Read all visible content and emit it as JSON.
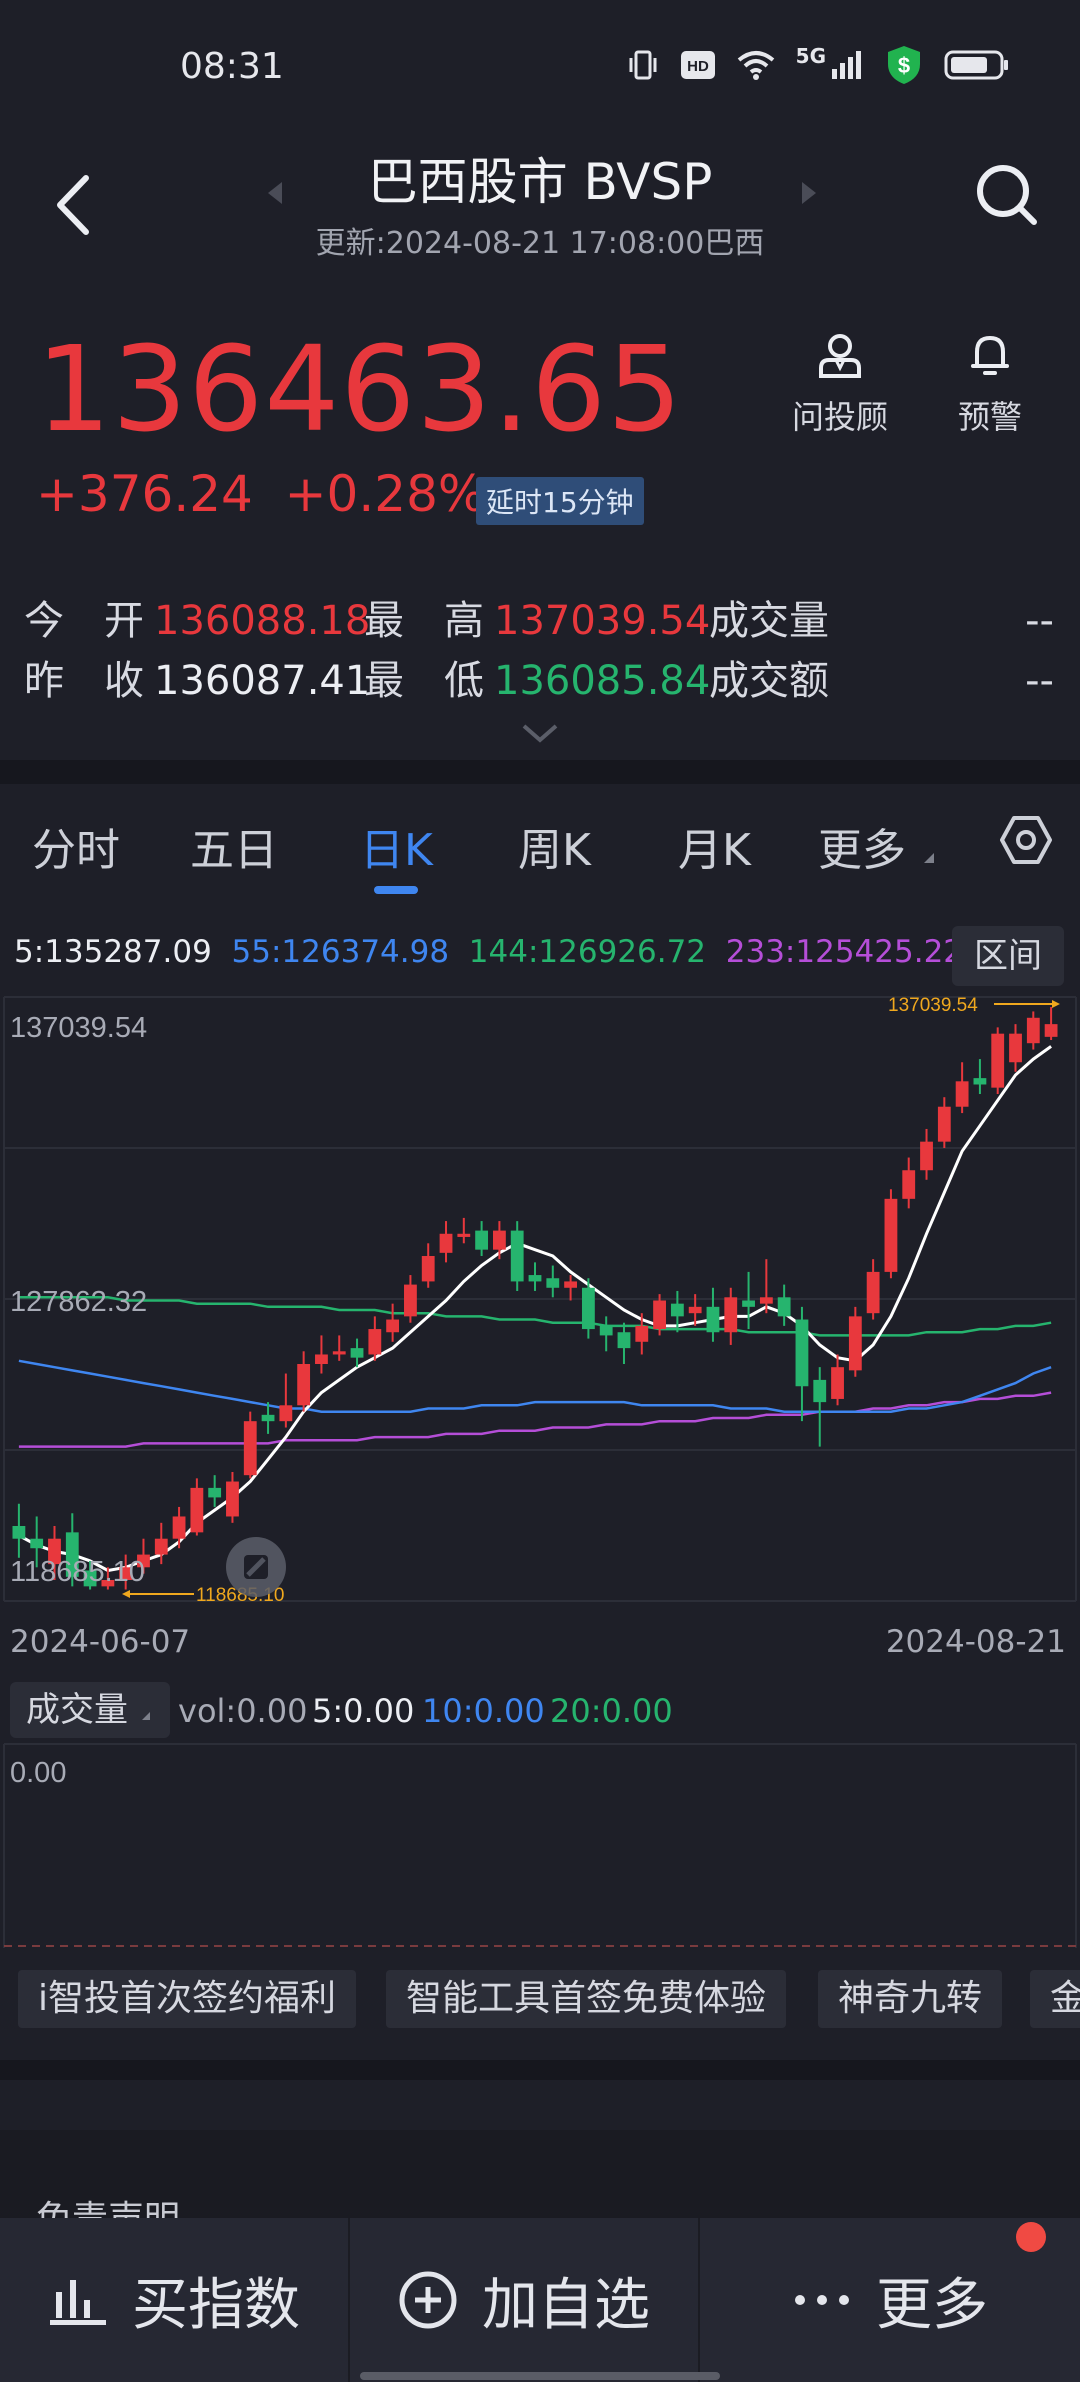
{
  "status": {
    "time": "08:31",
    "network": "5G"
  },
  "header": {
    "title": "巴西股市 BVSP",
    "update": "更新:2024-08-21 17:08:00巴西"
  },
  "quote": {
    "price": "136463.65",
    "change": "+376.24",
    "change_pct": "+0.28%",
    "delay_badge": "延时15分钟",
    "advisor_label": "问投顾",
    "alert_label": "预警",
    "stats": {
      "open_label": "今　开",
      "open": "136088.18",
      "high_label": "最　高",
      "high": "137039.54",
      "volume_label": "成交量",
      "volume": "--",
      "prev_close_label": "昨　收",
      "prev_close": "136087.41",
      "low_label": "最　低",
      "low": "136085.84",
      "amount_label": "成交额",
      "amount": "--"
    }
  },
  "tabs": [
    "分时",
    "五日",
    "日K",
    "周K",
    "月K",
    "更多"
  ],
  "active_tab": "日K",
  "ma": {
    "ma5": "5:135287.09",
    "ma55": "55:126374.98",
    "ma144": "144:126926.72",
    "ma233": "233:125425.22",
    "range_label": "区间"
  },
  "chart_data": {
    "type": "candlestick",
    "y_top_label": "137039.54",
    "y_mid_label": "127862.32",
    "y_bottom_label": "118685.10",
    "max_marker": "137039.54",
    "min_marker": "118685.10",
    "ylim": [
      118685.1,
      137039.54
    ],
    "x_start": "2024-06-07",
    "x_end": "2024-08-21",
    "candles": [
      {
        "o": 120700,
        "c": 120300,
        "h": 121400,
        "l": 119700
      },
      {
        "o": 120300,
        "c": 120000,
        "h": 121000,
        "l": 119400
      },
      {
        "o": 119500,
        "c": 120300,
        "h": 120700,
        "l": 119000
      },
      {
        "o": 120500,
        "c": 119100,
        "h": 121100,
        "l": 118800
      },
      {
        "o": 119300,
        "c": 118800,
        "h": 119600,
        "l": 118700
      },
      {
        "o": 118800,
        "c": 119000,
        "h": 119400,
        "l": 118700
      },
      {
        "o": 119000,
        "c": 119400,
        "h": 119800,
        "l": 118700
      },
      {
        "o": 119400,
        "c": 119800,
        "h": 120300,
        "l": 119200
      },
      {
        "o": 119800,
        "c": 120300,
        "h": 120800,
        "l": 119500
      },
      {
        "o": 120300,
        "c": 121000,
        "h": 121300,
        "l": 120000
      },
      {
        "o": 120500,
        "c": 121900,
        "h": 122200,
        "l": 120400
      },
      {
        "o": 121900,
        "c": 121600,
        "h": 122300,
        "l": 121300
      },
      {
        "o": 121000,
        "c": 122100,
        "h": 122400,
        "l": 120800
      },
      {
        "o": 122300,
        "c": 124000,
        "h": 124300,
        "l": 122200
      },
      {
        "o": 124200,
        "c": 124000,
        "h": 124600,
        "l": 123600
      },
      {
        "o": 124000,
        "c": 124500,
        "h": 125500,
        "l": 123800
      },
      {
        "o": 124500,
        "c": 125800,
        "h": 126200,
        "l": 124300
      },
      {
        "o": 125800,
        "c": 126100,
        "h": 126700,
        "l": 125500
      },
      {
        "o": 126100,
        "c": 126200,
        "h": 126700,
        "l": 125900
      },
      {
        "o": 126300,
        "c": 126000,
        "h": 126600,
        "l": 125700
      },
      {
        "o": 126100,
        "c": 126900,
        "h": 127300,
        "l": 125900
      },
      {
        "o": 126800,
        "c": 127200,
        "h": 127700,
        "l": 126500
      },
      {
        "o": 127300,
        "c": 128300,
        "h": 128600,
        "l": 127100
      },
      {
        "o": 128400,
        "c": 129200,
        "h": 129600,
        "l": 128200
      },
      {
        "o": 129300,
        "c": 129900,
        "h": 130300,
        "l": 129000
      },
      {
        "o": 129800,
        "c": 129900,
        "h": 130400,
        "l": 129600
      },
      {
        "o": 130000,
        "c": 129400,
        "h": 130300,
        "l": 129200
      },
      {
        "o": 129400,
        "c": 130000,
        "h": 130300,
        "l": 129100
      },
      {
        "o": 130000,
        "c": 128400,
        "h": 130300,
        "l": 128100
      },
      {
        "o": 128600,
        "c": 128400,
        "h": 129000,
        "l": 128100
      },
      {
        "o": 128500,
        "c": 128200,
        "h": 128900,
        "l": 127900
      },
      {
        "o": 128200,
        "c": 128400,
        "h": 128600,
        "l": 127800
      },
      {
        "o": 128200,
        "c": 126900,
        "h": 128500,
        "l": 126600
      },
      {
        "o": 127000,
        "c": 126700,
        "h": 127300,
        "l": 126200
      },
      {
        "o": 126800,
        "c": 126300,
        "h": 127100,
        "l": 125800
      },
      {
        "o": 126500,
        "c": 127000,
        "h": 127400,
        "l": 126100
      },
      {
        "o": 126900,
        "c": 127800,
        "h": 128000,
        "l": 126700
      },
      {
        "o": 127700,
        "c": 127300,
        "h": 128100,
        "l": 126800
      },
      {
        "o": 127400,
        "c": 127600,
        "h": 128000,
        "l": 127000
      },
      {
        "o": 127600,
        "c": 126800,
        "h": 128200,
        "l": 126500
      },
      {
        "o": 126800,
        "c": 127900,
        "h": 128200,
        "l": 126400
      },
      {
        "o": 127800,
        "c": 127600,
        "h": 128700,
        "l": 126900
      },
      {
        "o": 127700,
        "c": 127900,
        "h": 129100,
        "l": 127400
      },
      {
        "o": 127900,
        "c": 127300,
        "h": 128300,
        "l": 127000
      },
      {
        "o": 127200,
        "c": 125100,
        "h": 127600,
        "l": 124000
      },
      {
        "o": 125300,
        "c": 124600,
        "h": 125700,
        "l": 123200
      },
      {
        "o": 124700,
        "c": 125700,
        "h": 126100,
        "l": 124500
      },
      {
        "o": 125600,
        "c": 127300,
        "h": 127600,
        "l": 125400
      },
      {
        "o": 127400,
        "c": 128700,
        "h": 129100,
        "l": 127200
      },
      {
        "o": 128700,
        "c": 131000,
        "h": 131300,
        "l": 128500
      },
      {
        "o": 131000,
        "c": 131900,
        "h": 132300,
        "l": 130700
      },
      {
        "o": 131900,
        "c": 132800,
        "h": 133200,
        "l": 131600
      },
      {
        "o": 132800,
        "c": 133900,
        "h": 134200,
        "l": 132600
      },
      {
        "o": 133900,
        "c": 134700,
        "h": 135300,
        "l": 133700
      },
      {
        "o": 134800,
        "c": 134600,
        "h": 135400,
        "l": 134300
      },
      {
        "o": 134500,
        "c": 136200,
        "h": 136400,
        "l": 134300
      },
      {
        "o": 135300,
        "c": 136200,
        "h": 136500,
        "l": 135000
      },
      {
        "o": 135900,
        "c": 136700,
        "h": 136900,
        "l": 135700
      },
      {
        "o": 136100,
        "c": 136500,
        "h": 137039,
        "l": 136000
      }
    ],
    "ma5": [
      120400,
      120100,
      119900,
      119800,
      119600,
      119300,
      119400,
      119600,
      119800,
      120200,
      120800,
      121200,
      121600,
      122100,
      122800,
      123500,
      124300,
      124900,
      125300,
      125700,
      126000,
      126300,
      126800,
      127300,
      127800,
      128400,
      128900,
      129300,
      129600,
      129400,
      129200,
      128700,
      128300,
      127900,
      127500,
      127200,
      127000,
      127000,
      127100,
      127200,
      127300,
      127300,
      127600,
      127400,
      127000,
      126400,
      126000,
      125900,
      126400,
      127300,
      128500,
      129900,
      131200,
      132500,
      133300,
      134100,
      134900,
      135400,
      135800
    ],
    "ma55": [
      125900,
      125800,
      125700,
      125600,
      125500,
      125400,
      125300,
      125200,
      125100,
      125000,
      124900,
      124800,
      124700,
      124600,
      124500,
      124400,
      124400,
      124300,
      124300,
      124300,
      124300,
      124300,
      124300,
      124400,
      124400,
      124400,
      124500,
      124500,
      124500,
      124600,
      124600,
      124600,
      124600,
      124600,
      124600,
      124500,
      124500,
      124500,
      124500,
      124500,
      124400,
      124400,
      124400,
      124300,
      124300,
      124300,
      124300,
      124300,
      124300,
      124300,
      124400,
      124400,
      124500,
      124600,
      124800,
      125000,
      125200,
      125500,
      125700
    ],
    "ma144": [
      127900,
      127900,
      127900,
      127900,
      127900,
      127900,
      127800,
      127800,
      127800,
      127800,
      127700,
      127700,
      127700,
      127700,
      127600,
      127600,
      127600,
      127600,
      127500,
      127500,
      127500,
      127400,
      127400,
      127400,
      127300,
      127300,
      127300,
      127200,
      127200,
      127200,
      127100,
      127100,
      127100,
      127000,
      127000,
      127000,
      126900,
      126900,
      126900,
      126900,
      126900,
      126800,
      126800,
      126800,
      126800,
      126700,
      126700,
      126700,
      126700,
      126700,
      126700,
      126800,
      126800,
      126800,
      126900,
      126900,
      127000,
      127000,
      127100
    ],
    "ma233": [
      123200,
      123200,
      123200,
      123200,
      123200,
      123200,
      123200,
      123300,
      123300,
      123300,
      123300,
      123300,
      123300,
      123300,
      123300,
      123400,
      123400,
      123400,
      123400,
      123400,
      123500,
      123500,
      123500,
      123500,
      123600,
      123600,
      123600,
      123700,
      123700,
      123700,
      123800,
      123800,
      123800,
      123900,
      123900,
      123900,
      124000,
      124000,
      124000,
      124100,
      124100,
      124100,
      124200,
      124200,
      124200,
      124300,
      124300,
      124300,
      124400,
      124400,
      124500,
      124500,
      124600,
      124600,
      124700,
      124700,
      124800,
      124800,
      124900
    ]
  },
  "volume": {
    "selector_label": "成交量",
    "vol": "vol:0.00",
    "v5": "5:0.00",
    "v10": "10:0.00",
    "v20": "20:0.00",
    "axis_label": "0.00"
  },
  "promos": [
    "i智投首次签约福利",
    "智能工具首签免费体验",
    "神奇九转",
    "金"
  ],
  "disclaimer_title": "免责声明",
  "bottom_bar": {
    "buy_label": "买指数",
    "watch_label": "加自选",
    "more_label": "更多"
  },
  "colors": {
    "up": "#e8383d",
    "down": "#26b46e",
    "accent": "#3f86f0",
    "ma5": "#ffffff",
    "ma55": "#3f86f0",
    "ma144": "#26b46e",
    "ma233": "#b54ed8",
    "marker": "#f0a81e"
  }
}
